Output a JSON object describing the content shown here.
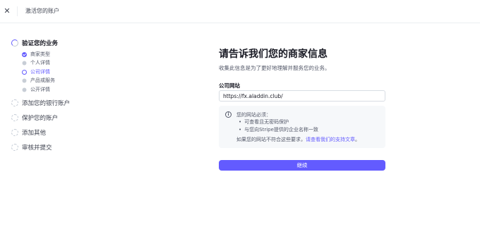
{
  "header": {
    "close_icon": "close-icon",
    "title": "激活您的账户"
  },
  "stepper": {
    "steps": [
      {
        "label": "验证您的业务",
        "status": "active"
      },
      {
        "label": "添加您的银行账户",
        "status": "todo"
      },
      {
        "label": "保护您的账户",
        "status": "todo"
      },
      {
        "label": "添加其他",
        "status": "todo"
      },
      {
        "label": "审核并提交",
        "status": "todo"
      }
    ],
    "substeps": [
      {
        "label": "商家类型",
        "status": "done"
      },
      {
        "label": "个人详情",
        "status": "todo"
      },
      {
        "label": "公司详情",
        "status": "current"
      },
      {
        "label": "产品或服务",
        "status": "todo"
      },
      {
        "label": "公开详情",
        "status": "todo"
      }
    ]
  },
  "main": {
    "title": "请告诉我们您的商家信息",
    "subtitle": "收集此信息是为了更好地理解并服务您的业务。",
    "website_field": {
      "label": "公司网站",
      "value": "https://fx.aladdin.club/"
    },
    "info": {
      "icon": "info-icon",
      "heading": "您的网站必须：",
      "items": [
        "可查看且无密码保护",
        "与您向Stripe提供的企业名称一致"
      ],
      "footer_text": "如果您的网站不符合这些要求，",
      "footer_link": "请查看我们的支持文章",
      "footer_end": "。"
    },
    "continue_label": "继续"
  },
  "colors": {
    "accent": "#635bff",
    "text_primary": "#1a1b25",
    "text_secondary": "#545969",
    "info_bg": "#f6f8fa"
  }
}
